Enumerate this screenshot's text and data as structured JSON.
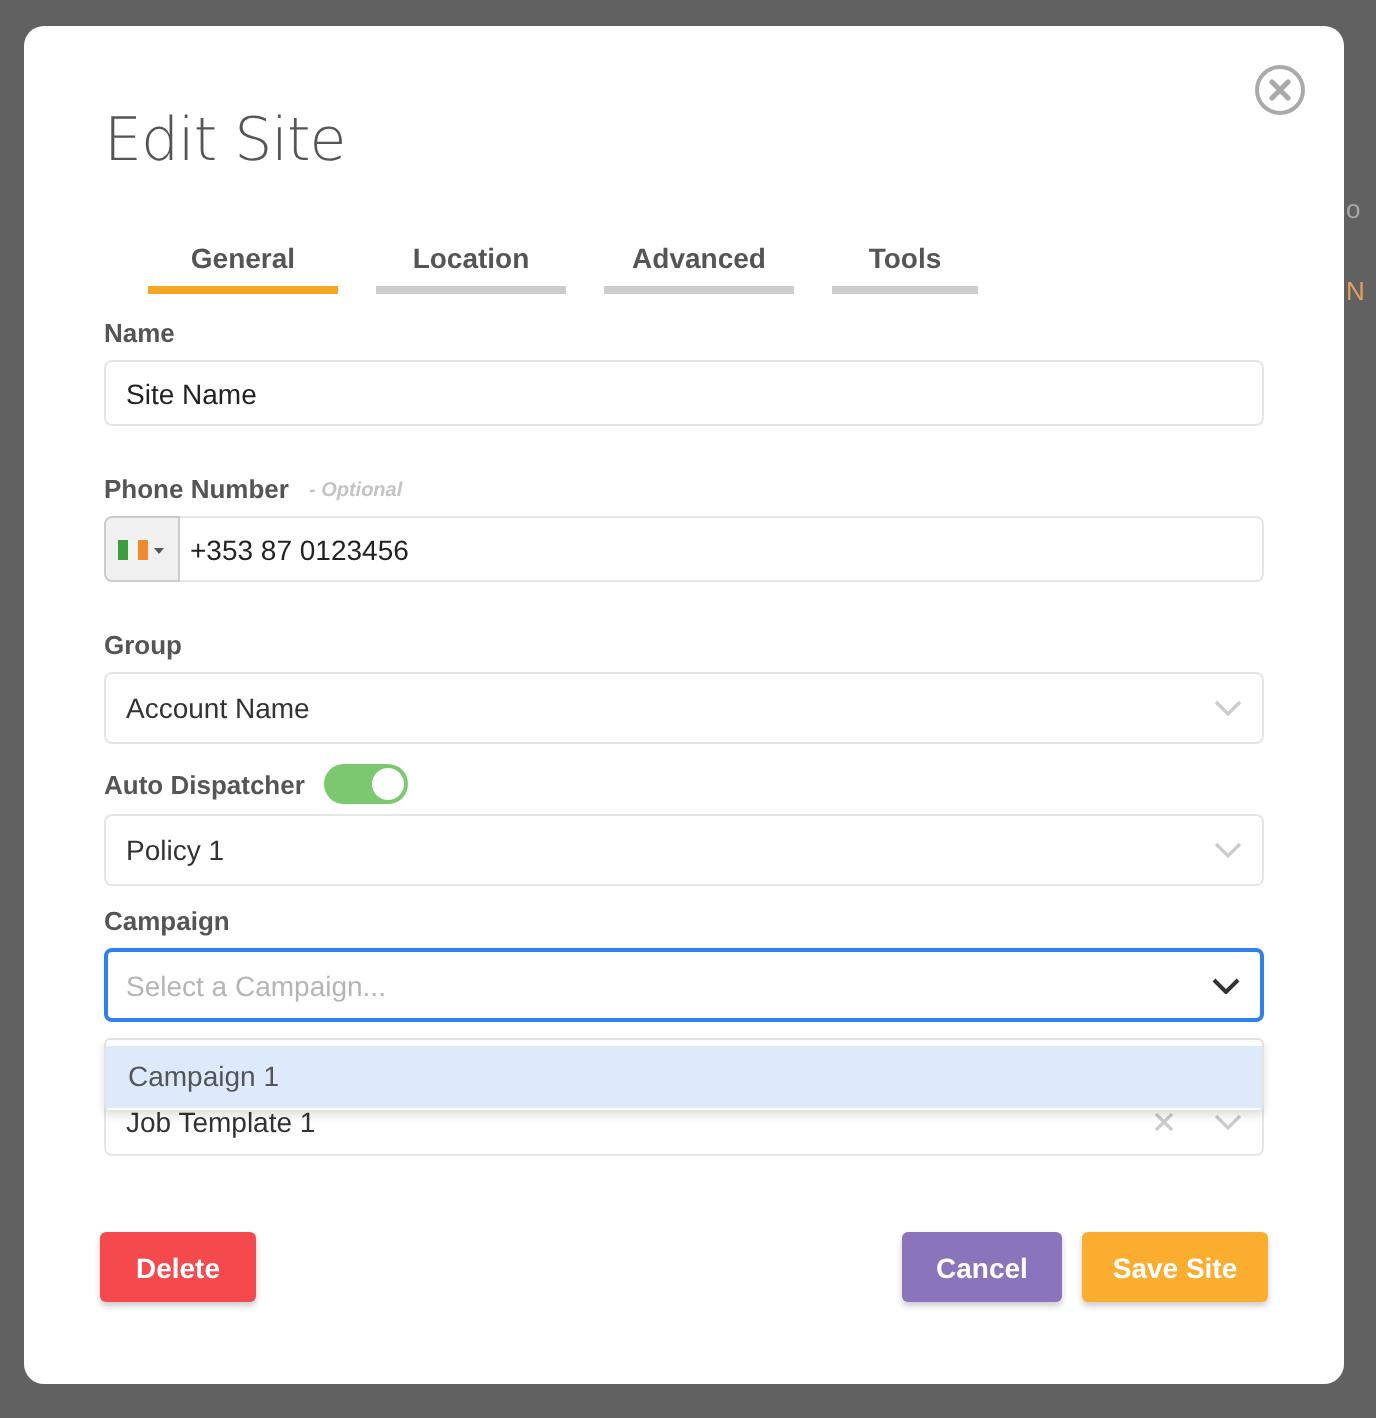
{
  "backdrop": {
    "fragments": [
      "o",
      "N"
    ]
  },
  "dialog": {
    "title": "Edit Site",
    "tabs": [
      {
        "label": "General",
        "selected": true
      },
      {
        "label": "Location",
        "selected": false
      },
      {
        "label": "Advanced",
        "selected": false
      },
      {
        "label": "Tools",
        "selected": false
      }
    ],
    "name": {
      "label": "Name",
      "value": "Site Name"
    },
    "phone": {
      "label": "Phone Number",
      "note": "- Optional",
      "value": "+353 87 0123456"
    },
    "group": {
      "label": "Group",
      "value": "Account Name"
    },
    "auto_dispatcher": {
      "label": "Auto Dispatcher",
      "on": true,
      "value": "Policy 1"
    },
    "campaign": {
      "label": "Campaign",
      "placeholder": "Select a Campaign...",
      "focused": true,
      "options": [
        {
          "label": "Campaign 1",
          "selected": true
        }
      ]
    },
    "job_template": {
      "value": "Job Template 1"
    },
    "buttons": {
      "delete": "Delete",
      "cancel": "Cancel",
      "save": "Save Site"
    }
  }
}
